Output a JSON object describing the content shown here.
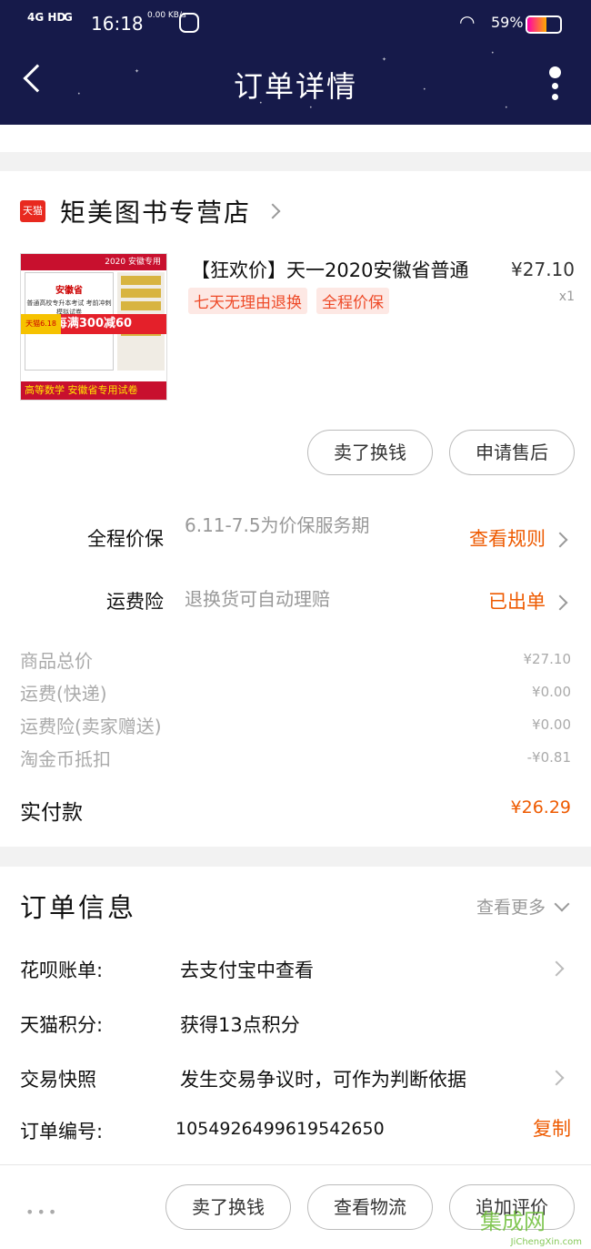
{
  "status_bar": {
    "network": "4G HD",
    "network2": "G",
    "time": "16:18",
    "speed": "0.00 KB/s",
    "battery_percent": "59%",
    "battery_level": 0.59
  },
  "header": {
    "title": "订单详情"
  },
  "shop": {
    "badge": "天猫",
    "name": "矩美图书专营店"
  },
  "product": {
    "title": "【狂欢价】天一2020安徽省普通",
    "price": "¥27.10",
    "quantity": "x1",
    "tags": [
      "七天无理由退换",
      "全程价保"
    ],
    "image": {
      "year_badge": "2020 安徽专用",
      "cover_title": "安徽省",
      "cover_sub": "普通高校专升本考试 考前冲刺模拟试卷",
      "promo_left": "天猫6.18",
      "promo": "每满300减60",
      "footer": "高等数学  安徽省专用试卷"
    }
  },
  "actions": {
    "sell_button": "卖了换钱",
    "after_sale_button": "申请售后"
  },
  "services": [
    {
      "label": "全程价保",
      "desc": "6.11-7.5为价保服务期",
      "link": "查看规则"
    },
    {
      "label": "运费险",
      "desc": "退换货可自动理赔",
      "link": "已出单"
    }
  ],
  "fees": [
    {
      "label": "商品总价",
      "value": "¥27.10"
    },
    {
      "label": "运费(快递)",
      "value": "¥0.00"
    },
    {
      "label": "运费险(卖家赠送)",
      "value": "¥0.00"
    },
    {
      "label": "淘金币抵扣",
      "value": "-¥0.81"
    }
  ],
  "paid": {
    "label": "实付款",
    "value": "¥26.29"
  },
  "order_info": {
    "title": "订单信息",
    "more": "查看更多",
    "rows": [
      {
        "label": "花呗账单:",
        "value": "去支付宝中查看"
      },
      {
        "label": "天猫积分:",
        "value": "获得13点积分"
      },
      {
        "label": "交易快照",
        "value": "发生交易争议时，可作为判断依据"
      },
      {
        "label": "订单编号:",
        "value": "1054926499619542650"
      }
    ],
    "copy": "复制"
  },
  "bottom": {
    "more": "•••",
    "buttons": [
      "卖了换钱",
      "查看物流",
      "追加评价"
    ]
  },
  "watermark": {
    "text": "集成网",
    "sub": "JiChengXin.com"
  },
  "colors": {
    "header_bg": "#161a4a",
    "accent": "#ee5a00",
    "tag_bg": "#fde8e4"
  }
}
